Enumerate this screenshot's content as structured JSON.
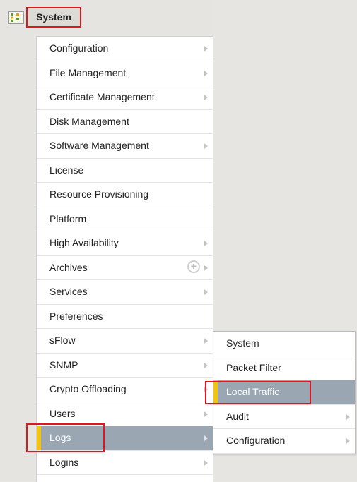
{
  "header": {
    "title": "System"
  },
  "main_menu": [
    {
      "label": "Configuration",
      "arrow": true
    },
    {
      "label": "File Management",
      "arrow": true
    },
    {
      "label": "Certificate Management",
      "arrow": true
    },
    {
      "label": "Disk Management",
      "arrow": false
    },
    {
      "label": "Software Management",
      "arrow": true
    },
    {
      "label": "License",
      "arrow": false
    },
    {
      "label": "Resource Provisioning",
      "arrow": false
    },
    {
      "label": "Platform",
      "arrow": false
    },
    {
      "label": "High Availability",
      "arrow": true
    },
    {
      "label": "Archives",
      "arrow": true,
      "plus": "+"
    },
    {
      "label": "Services",
      "arrow": true
    },
    {
      "label": "Preferences",
      "arrow": false
    },
    {
      "label": "sFlow",
      "arrow": true
    },
    {
      "label": "SNMP",
      "arrow": true
    },
    {
      "label": "Crypto Offloading",
      "arrow": true
    },
    {
      "label": "Users",
      "arrow": true
    },
    {
      "label": "Logs",
      "arrow": true,
      "active": true
    },
    {
      "label": "Logins",
      "arrow": true
    }
  ],
  "sub_menu": [
    {
      "label": "System",
      "arrow": false
    },
    {
      "label": "Packet Filter",
      "arrow": false
    },
    {
      "label": "Local Traffic",
      "arrow": false,
      "active": true
    },
    {
      "label": "Audit",
      "arrow": true
    },
    {
      "label": "Configuration",
      "arrow": true
    }
  ],
  "colors": {
    "highlight": "#e0151d",
    "active_bg": "#9aa6b2",
    "active_marker": "#f2c40f"
  },
  "icons": {
    "header": "system-grid-icon"
  }
}
